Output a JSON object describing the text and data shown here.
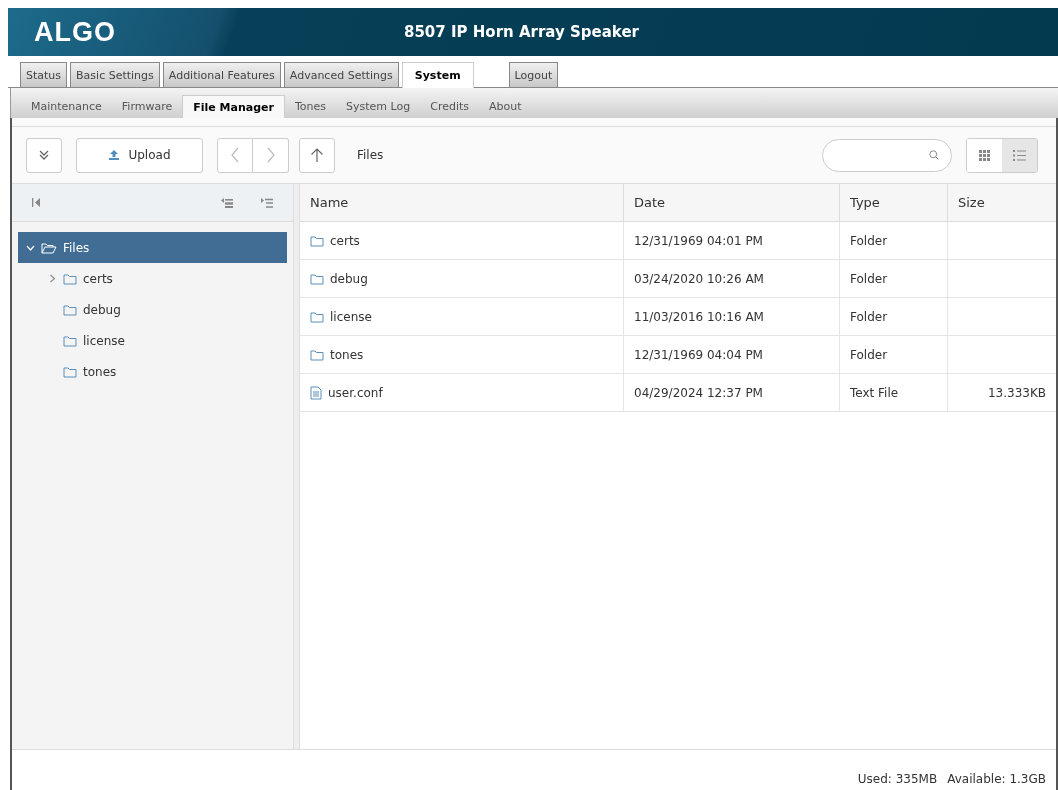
{
  "header": {
    "logo": "ALGO",
    "title": "8507 IP Horn Array Speaker"
  },
  "tabs": [
    {
      "label": "Status",
      "selected": false
    },
    {
      "label": "Basic Settings",
      "selected": false
    },
    {
      "label": "Additional Features",
      "selected": false
    },
    {
      "label": "Advanced Settings",
      "selected": false
    },
    {
      "label": "System",
      "selected": true
    },
    {
      "label": "Logout",
      "selected": false
    }
  ],
  "subtabs": [
    {
      "label": "Maintenance",
      "selected": false
    },
    {
      "label": "Firmware",
      "selected": false
    },
    {
      "label": "File Manager",
      "selected": true
    },
    {
      "label": "Tones",
      "selected": false
    },
    {
      "label": "System Log",
      "selected": false
    },
    {
      "label": "Credits",
      "selected": false
    },
    {
      "label": "About",
      "selected": false
    }
  ],
  "toolbar": {
    "upload": "Upload",
    "path": "Files",
    "views": [
      {
        "kind": "grid",
        "selected": false
      },
      {
        "kind": "list",
        "selected": true
      }
    ]
  },
  "tree": [
    {
      "label": "Files",
      "selected": true,
      "expandable": true,
      "expanded": true,
      "children": [
        {
          "label": "certs",
          "selected": false,
          "expandable": true,
          "expanded": false
        },
        {
          "label": "debug",
          "selected": false,
          "expandable": false,
          "expanded": false
        },
        {
          "label": "license",
          "selected": false,
          "expandable": false,
          "expanded": false
        },
        {
          "label": "tones",
          "selected": false,
          "expandable": false,
          "expanded": false
        }
      ]
    }
  ],
  "table": {
    "columns": [
      "Name",
      "Date",
      "Type",
      "Size"
    ],
    "rows": [
      {
        "kind": "folder",
        "name": "certs",
        "date": "12/31/1969 04:01 PM",
        "type": "Folder"
      },
      {
        "kind": "folder",
        "name": "debug",
        "date": "03/24/2020 10:26 AM",
        "type": "Folder"
      },
      {
        "kind": "folder",
        "name": "license",
        "date": "11/03/2016 10:16 AM",
        "type": "Folder"
      },
      {
        "kind": "folder",
        "name": "tones",
        "date": "12/31/1969 04:04 PM",
        "type": "Folder"
      },
      {
        "kind": "file",
        "name": "user.conf",
        "date": "04/29/2024 12:37 PM",
        "type": "Text File",
        "size": "13.333KB"
      }
    ]
  },
  "status_bar": {
    "used": "Used: 335MB",
    "available": "Available: 1.3GB"
  }
}
